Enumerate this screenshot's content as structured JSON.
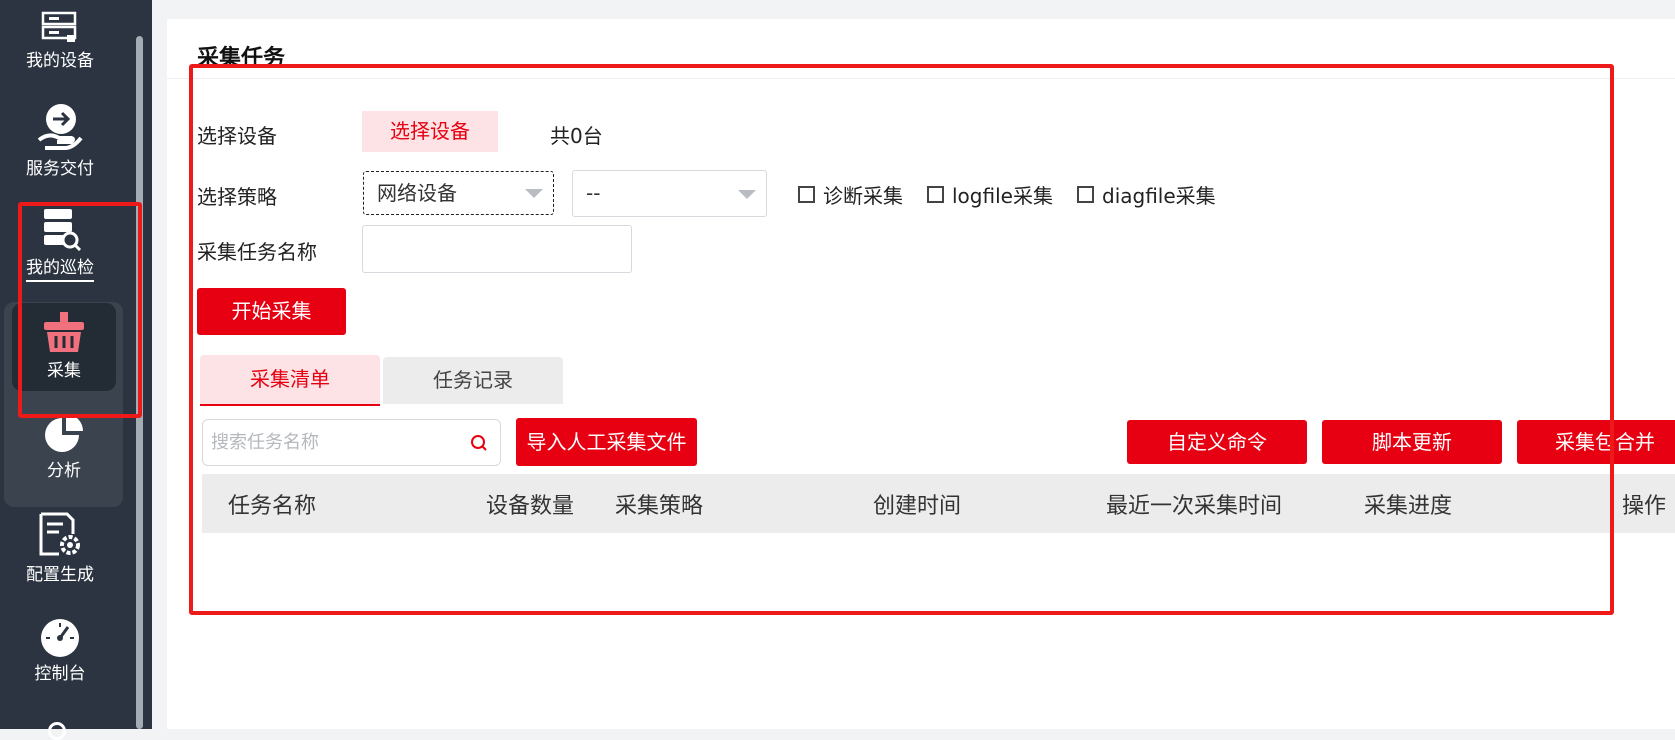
{
  "sidebar": {
    "items": [
      {
        "label": "我的设备",
        "icon": "server-icon"
      },
      {
        "label": "服务交付",
        "icon": "service-delivery-icon"
      },
      {
        "label": "我的巡检",
        "icon": "inspection-icon"
      },
      {
        "label": "采集",
        "icon": "basket-icon"
      },
      {
        "label": "分析",
        "icon": "pie-chart-icon"
      },
      {
        "label": "配置生成",
        "icon": "config-gear-icon"
      },
      {
        "label": "控制台",
        "icon": "dashboard-gauge-icon"
      }
    ]
  },
  "page": {
    "title": "采集任务"
  },
  "form": {
    "device_label": "选择设备",
    "device_button": "选择设备",
    "device_count": "共0台",
    "strategy_label": "选择策略",
    "strategy_select_1": "网络设备",
    "strategy_select_2": "--",
    "checkboxes": [
      "诊断采集",
      "logfile采集",
      "diagfile采集"
    ],
    "task_name_label": "采集任务名称",
    "task_name_value": "",
    "start_button": "开始采集"
  },
  "tabs": [
    "采集清单",
    "任务记录"
  ],
  "toolbar": {
    "search_placeholder": "搜索任务名称",
    "import_button": "导入人工采集文件",
    "custom_command_button": "自定义命令",
    "script_update_button": "脚本更新",
    "merge_button": "采集包合并"
  },
  "table": {
    "columns": [
      "任务名称",
      "设备数量",
      "采集策略",
      "创建时间",
      "最近一次采集时间",
      "采集进度",
      "操作"
    ]
  },
  "colors": {
    "sidebar_bg": "#2b3440",
    "accent": "#e60012",
    "accent_light": "#fde3e5",
    "highlight_box": "#ee1a1a"
  }
}
